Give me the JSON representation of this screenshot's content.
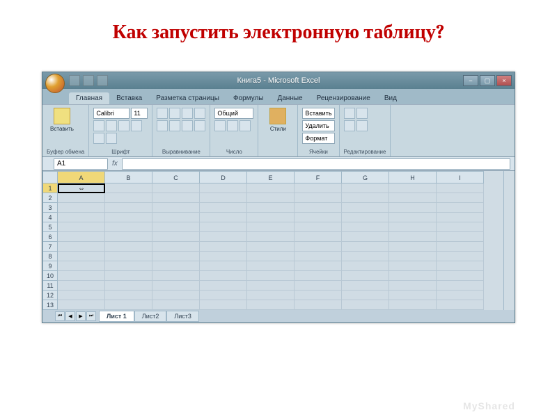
{
  "page": {
    "title": "Как запустить электронную таблицу?"
  },
  "window": {
    "title": "Книга5 - Microsoft Excel"
  },
  "tabs": {
    "t0": "Главная",
    "t1": "Вставка",
    "t2": "Разметка страницы",
    "t3": "Формулы",
    "t4": "Данные",
    "t5": "Рецензирование",
    "t6": "Вид"
  },
  "ribbon": {
    "clipboard": {
      "paste": "Вставить",
      "label": "Буфер обмена"
    },
    "font": {
      "name": "Calibri",
      "size": "11",
      "label": "Шрифт"
    },
    "align": {
      "label": "Выравнивание"
    },
    "number": {
      "format": "Общий",
      "label": "Число"
    },
    "styles": {
      "btn": "Стили",
      "label": ""
    },
    "cells": {
      "insert": "Вставить",
      "delete": "Удалить",
      "format": "Формат",
      "label": "Ячейки"
    },
    "editing": {
      "label": "Редактирование"
    }
  },
  "namebox": "A1",
  "fx": "fx",
  "cols": {
    "c0": "A",
    "c1": "B",
    "c2": "C",
    "c3": "D",
    "c4": "E",
    "c5": "F",
    "c6": "G",
    "c7": "H",
    "c8": "I"
  },
  "rows": {
    "r1": "1",
    "r2": "2",
    "r3": "3",
    "r4": "4",
    "r5": "5",
    "r6": "6",
    "r7": "7",
    "r8": "8",
    "r9": "9",
    "r10": "10",
    "r11": "11",
    "r12": "12",
    "r13": "13"
  },
  "cursor": "⇔",
  "sheets": {
    "s1": "Лист 1",
    "s2": "Лист2",
    "s3": "Лист3"
  },
  "watermark": "MyShared"
}
